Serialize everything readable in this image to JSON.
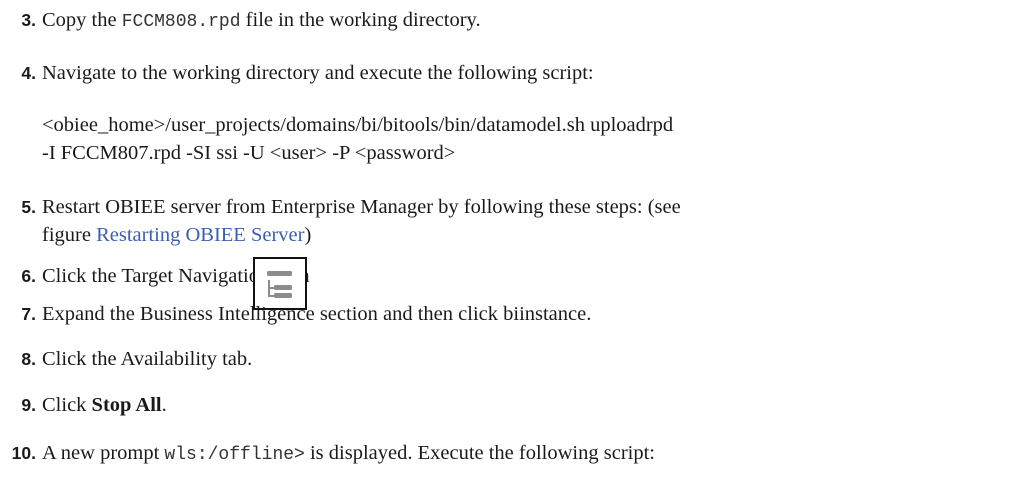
{
  "steps": [
    {
      "number": "3.",
      "text_before": "Copy the ",
      "code": "FCCM808.rpd",
      "text_after": " file in the working directory."
    },
    {
      "number": "4.",
      "text": "Navigate to the working directory and execute the following script:",
      "script_line1": "<obiee_home>/user_projects/domains/bi/bitools/bin/datamodel.sh uploadrpd",
      "script_line2": "-I FCCM807.rpd -SI ssi -U <user> -P <password>"
    },
    {
      "number": "5.",
      "text_line1": "Restart OBIEE server from Enterprise Manager by following these steps: (see",
      "text_line2_before": "figure ",
      "link": "Restarting OBIEE Server",
      "text_line2_after": ")"
    },
    {
      "number": "6.",
      "text": "Click the Target Navigation icon",
      "icon": "target-navigation-icon"
    },
    {
      "number": "7.",
      "text": "Expand the Business Intelligence section and then click biinstance."
    },
    {
      "number": "8.",
      "text": "Click the Availability tab."
    },
    {
      "number": "9.",
      "text_before": "Click ",
      "bold": "Stop All",
      "text_after": "."
    },
    {
      "number": "10.",
      "text_before": "A new prompt ",
      "code": "wls:/offline>",
      "text_after": " is displayed. Execute the following script:"
    }
  ],
  "colors": {
    "text": "#1a1a1a",
    "link": "#3a5fb0",
    "icon_gray": "#8c8c8c"
  }
}
